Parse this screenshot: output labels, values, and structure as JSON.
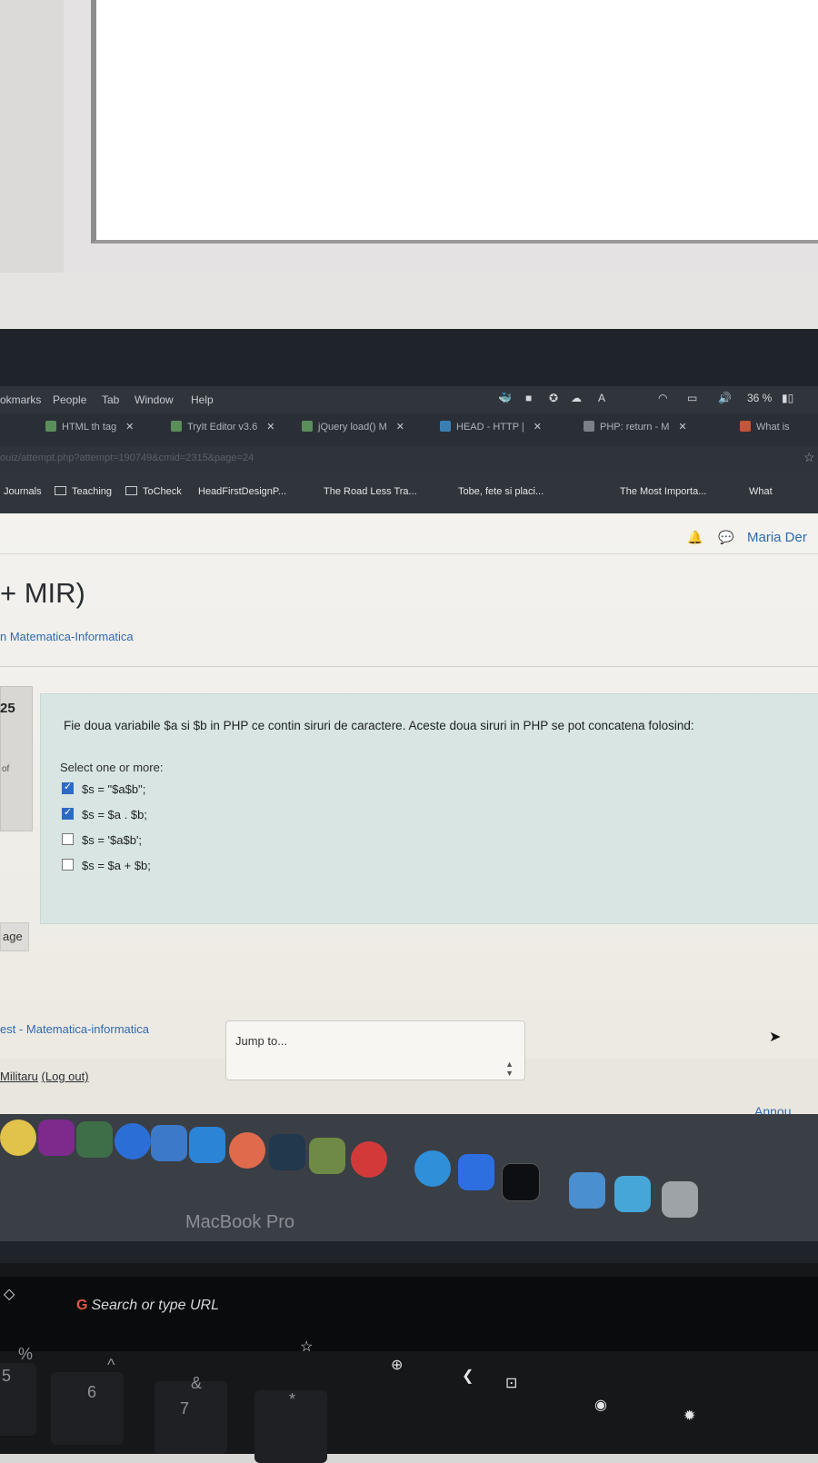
{
  "menubar": {
    "items": [
      "okmarks",
      "People",
      "Tab",
      "Window",
      "Help"
    ],
    "battery": "36 %"
  },
  "tabs": [
    {
      "label": "HTML th tag"
    },
    {
      "label": "TryIt Editor v3.6"
    },
    {
      "label": "jQuery load() M"
    },
    {
      "label": "HEAD - HTTP |"
    },
    {
      "label": "PHP: return - M"
    },
    {
      "label": "What is"
    }
  ],
  "url": "ouiz/attempt.php?attempt=190749&cmid=2315&page=24",
  "bookmarks": [
    {
      "label": "Journals"
    },
    {
      "label": "Teaching"
    },
    {
      "label": "ToCheck"
    },
    {
      "label": "HeadFirstDesignP..."
    },
    {
      "label": "The Road Less Tra..."
    },
    {
      "label": "Tobe, fete si placi..."
    },
    {
      "label": "The Most Importa..."
    },
    {
      "label": "What"
    }
  ],
  "header": {
    "user_name": "Maria Der"
  },
  "course": {
    "title": "+ MIR)",
    "subtitle": "n Matematica-Informatica"
  },
  "question": {
    "number": "25",
    "info_text": "of",
    "text": "Fie doua variabile $a si $b in PHP ce contin siruri de caractere. Aceste doua siruri in PHP se pot concatena folosind:",
    "prompt": "Select one or more:",
    "options": [
      {
        "label": "$s = \"$a$b\";",
        "checked": true
      },
      {
        "label": "$s = $a . $b;",
        "checked": true
      },
      {
        "label": "$s = '$a$b';",
        "checked": false
      },
      {
        "label": "$s = $a + $b;",
        "checked": false
      }
    ]
  },
  "nav": {
    "prev_page_label": "age"
  },
  "footer": {
    "course_link": "est - Matematica-informatica",
    "jump_to": "Jump to...",
    "logged_in_name": "Militaru",
    "logout_label": "(Log out)",
    "announcements": "Annou"
  },
  "device": {
    "label": "MacBook Pro",
    "touchbar_search": "Search or type URL",
    "keys": [
      "%",
      "5",
      "^",
      "6",
      "&",
      "7",
      "*"
    ]
  }
}
